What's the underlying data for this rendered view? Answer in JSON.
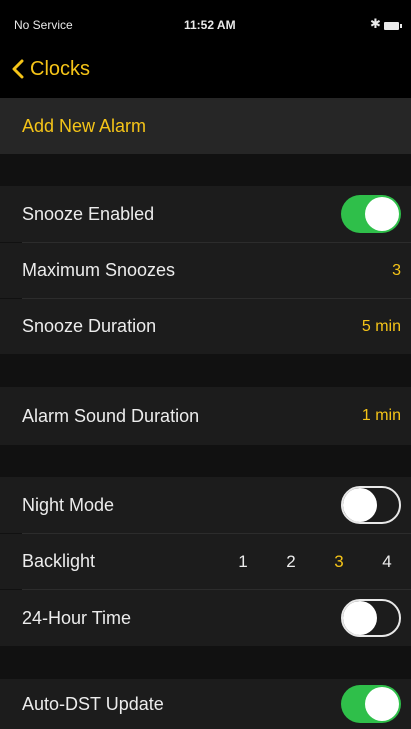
{
  "status_bar": {
    "carrier": "No Service",
    "time": "11:52 AM",
    "bluetooth_icon": "bluetooth-icon",
    "battery_icon": "battery-icon"
  },
  "nav": {
    "back_label": "Clocks",
    "back_icon": "chevron-left-icon"
  },
  "rows": {
    "add_alarm": "Add New Alarm",
    "snooze_enabled": {
      "label": "Snooze Enabled",
      "on": true
    },
    "max_snoozes": {
      "label": "Maximum Snoozes",
      "value": "3"
    },
    "snooze_duration": {
      "label": "Snooze Duration",
      "value": "5 min"
    },
    "alarm_sound_duration": {
      "label": "Alarm Sound Duration",
      "value": "1 min"
    },
    "night_mode": {
      "label": "Night Mode",
      "on": false
    },
    "backlight": {
      "label": "Backlight",
      "levels": [
        "1",
        "2",
        "3",
        "4"
      ],
      "selected": "3"
    },
    "hour_24": {
      "label": "24-Hour Time",
      "on": false
    },
    "auto_dst": {
      "label": "Auto-DST Update",
      "on": true
    }
  },
  "colors": {
    "accent": "#f5c418",
    "toggle_on": "#2fbf4a",
    "row_background": "#1c1c1c",
    "page_background": "#111111"
  }
}
